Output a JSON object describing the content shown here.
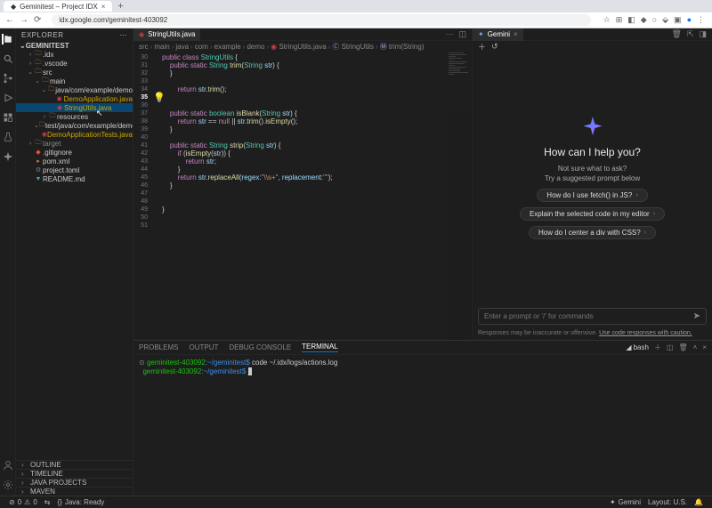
{
  "browser": {
    "tab_title": "Geminitest – Project IDX",
    "url": "idx.google.com/geminitest-403092"
  },
  "explorer": {
    "title": "EXPLORER",
    "project": "GEMINITEST",
    "tree": [
      {
        "depth": 1,
        "type": "folder",
        "open": false,
        "name": ".idx"
      },
      {
        "depth": 1,
        "type": "folder",
        "open": false,
        "name": ".vscode"
      },
      {
        "depth": 1,
        "type": "folder",
        "open": true,
        "name": "src"
      },
      {
        "depth": 2,
        "type": "folder",
        "open": true,
        "name": "main"
      },
      {
        "depth": 3,
        "type": "folder",
        "open": true,
        "name": "java/com/example/demo"
      },
      {
        "depth": 4,
        "type": "file",
        "icon": "java",
        "name": "DemoApplication.java",
        "git": "m"
      },
      {
        "depth": 4,
        "type": "file",
        "icon": "java",
        "name": "StringUtils.java",
        "git": "m",
        "selected": true
      },
      {
        "depth": 3,
        "type": "folder",
        "open": false,
        "name": "resources"
      },
      {
        "depth": 2,
        "type": "folder",
        "open": true,
        "name": "test/java/com/example/demo"
      },
      {
        "depth": 3,
        "type": "file",
        "icon": "java",
        "name": "DemoApplicationTests.java",
        "git": "m"
      },
      {
        "depth": 1,
        "type": "folder",
        "open": false,
        "name": "target",
        "dim": true
      },
      {
        "depth": 1,
        "type": "file",
        "icon": "git",
        "name": ".gitignore"
      },
      {
        "depth": 1,
        "type": "file",
        "icon": "xml",
        "name": "pom.xml"
      },
      {
        "depth": 1,
        "type": "file",
        "icon": "toml",
        "name": "project.toml"
      },
      {
        "depth": 1,
        "type": "file",
        "icon": "md",
        "name": "README.md"
      }
    ],
    "footer_sections": [
      "OUTLINE",
      "TIMELINE",
      "JAVA PROJECTS",
      "MAVEN"
    ]
  },
  "editor": {
    "tab1": "StringUtils.java",
    "breadcrumbs": [
      "src",
      "main",
      "java",
      "com",
      "example",
      "demo",
      "StringUtils.java",
      "StringUtils",
      "trim(String)"
    ],
    "lines": [
      {
        "n": 30,
        "html": "<span class='kw'>public</span> <span class='kw'>class</span> <span class='type'>StringUtils</span> {"
      },
      {
        "n": 31,
        "html": "    <span class='kw'>public</span> <span class='kw'>static</span> <span class='type'>String</span> <span class='fn'>trim</span>(<span class='type'>String</span> <span class='va'>str</span>) {"
      },
      {
        "n": 32,
        "html": "    }"
      },
      {
        "n": 33,
        "html": ""
      },
      {
        "n": 34,
        "html": "        <span class='kw'>return</span> <span class='va'>str</span>.<span class='fn'>trim</span>();"
      },
      {
        "n": 35,
        "html": "",
        "lightbulb": true
      },
      {
        "n": 36,
        "html": ""
      },
      {
        "n": 37,
        "html": "    <span class='kw'>public</span> <span class='kw'>static</span> <span class='type'>boolean</span> <span class='fn'>isBlank</span>(<span class='type'>String</span> <span class='va'>str</span>) {"
      },
      {
        "n": 38,
        "html": "        <span class='kw'>return</span> <span class='va'>str</span> == <span class='kw'>null</span> || <span class='va'>str</span>.<span class='fn'>trim</span>().<span class='fn'>isEmpty</span>();"
      },
      {
        "n": 39,
        "html": "    }"
      },
      {
        "n": 40,
        "html": ""
      },
      {
        "n": 41,
        "html": "    <span class='kw'>public</span> <span class='kw'>static</span> <span class='type'>String</span> <span class='fn'>strip</span>(<span class='type'>String</span> <span class='va'>str</span>) {"
      },
      {
        "n": 42,
        "html": "        <span class='kw'>if</span> (<span class='fn'>isEmpty</span>(<span class='va'>str</span>)) {"
      },
      {
        "n": 43,
        "html": "            <span class='kw'>return</span> <span class='va'>str</span>;"
      },
      {
        "n": 44,
        "html": "        }"
      },
      {
        "n": 45,
        "html": "        <span class='kw'>return</span> <span class='va'>str</span>.<span class='fn'>replaceAll</span>(<span class='va'>regex:</span><span class='str'>\"\\\\s+\"</span>, <span class='va'>replacement:</span><span class='str'>\"\"</span>);"
      },
      {
        "n": 46,
        "html": "    }"
      },
      {
        "n": 47,
        "html": ""
      },
      {
        "n": 48,
        "html": ""
      },
      {
        "n": 49,
        "html": "}"
      },
      {
        "n": 50,
        "html": ""
      },
      {
        "n": 51,
        "html": ""
      }
    ]
  },
  "gemini": {
    "tab": "Gemini",
    "heading": "How can I help you?",
    "sub1": "Not sure what to ask?",
    "sub2": "Try a suggested prompt below",
    "chip1": "How do I use fetch() in JS?",
    "chip2": "Explain the selected code in my editor",
    "chip3": "How do I center a div with CSS?",
    "placeholder": "Enter a prompt or '/' for commands",
    "disclaimer": "Responses may be inaccurate or offensive.",
    "disclaimer_link": "Use code responses with caution."
  },
  "terminal": {
    "tabs": {
      "problems": "PROBLEMS",
      "output": "OUTPUT",
      "debug": "DEBUG CONSOLE",
      "terminal": "TERMINAL"
    },
    "shell": "bash",
    "line1_user": "geminitest-403092",
    "line1_host": ":~/geminitest$",
    "line1_cmd": " code ~/.idx/logs/actions.log",
    "line2_user": "geminitest-403092",
    "line2_host": ":~/geminitest$",
    "line2_cmd": " "
  },
  "statusbar": {
    "java": "Java: Ready",
    "gemini": "Gemini",
    "layout": "Layout: U.S."
  }
}
